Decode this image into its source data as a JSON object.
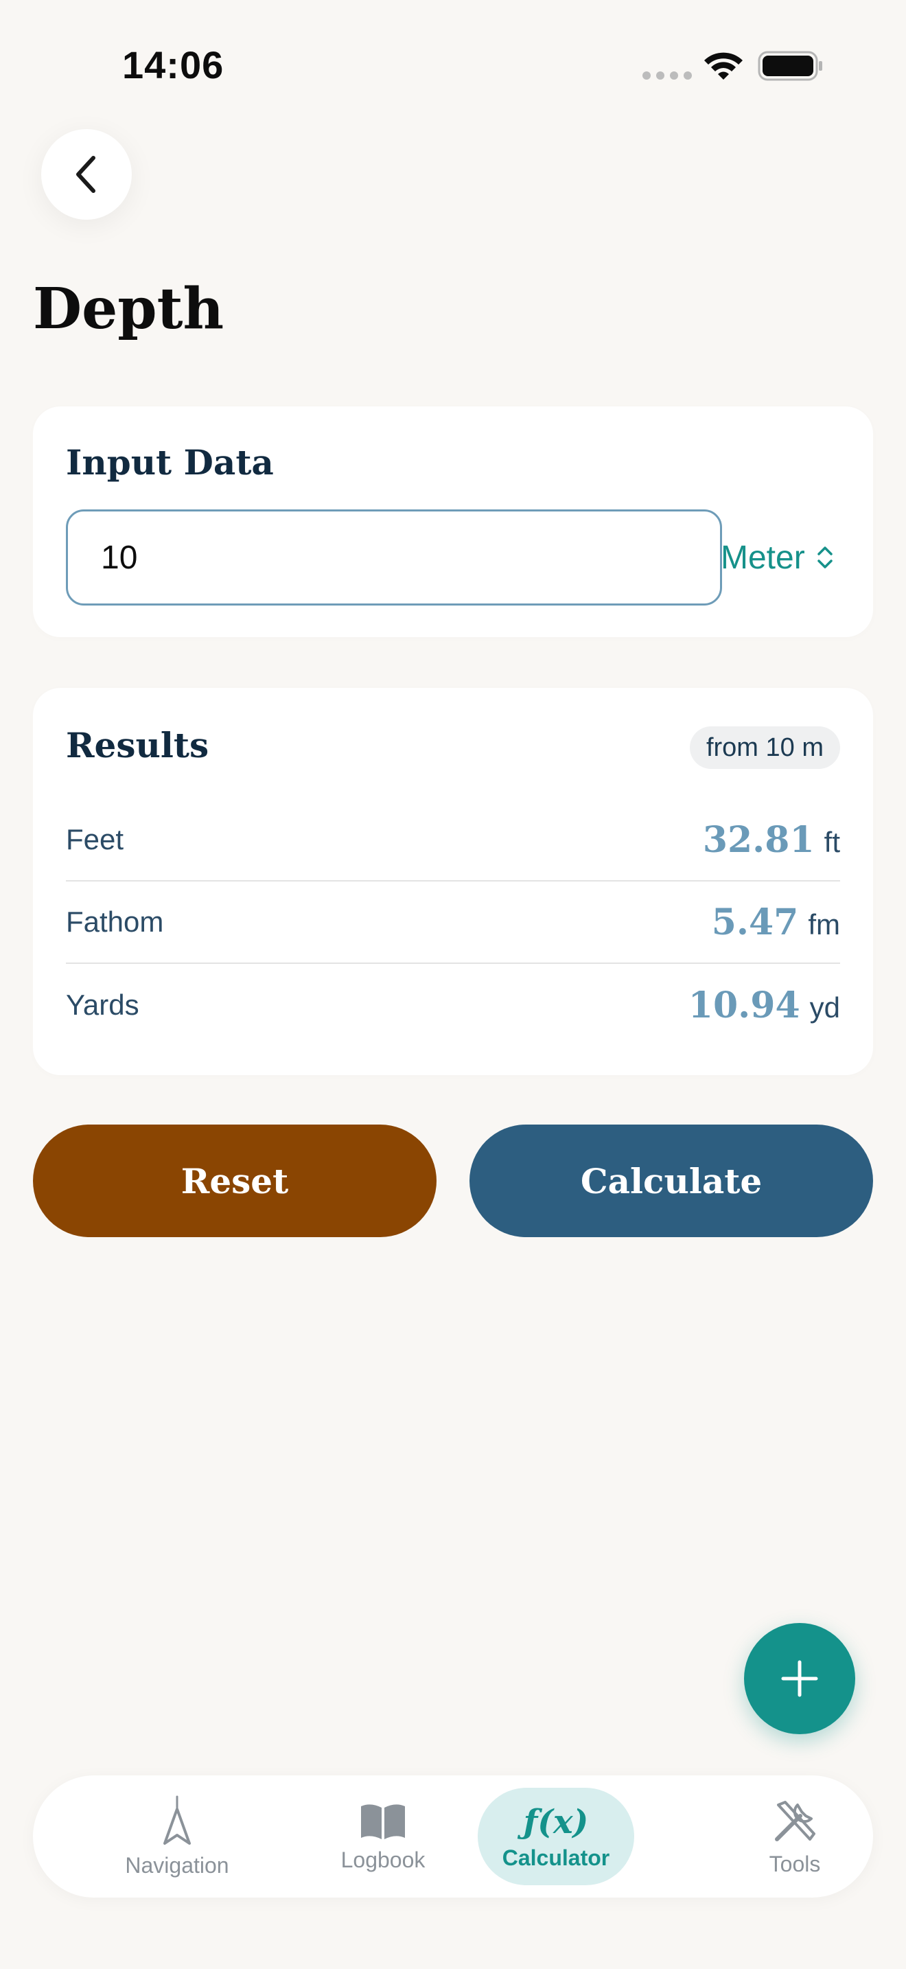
{
  "status_bar": {
    "time": "14:06"
  },
  "page": {
    "title": "Depth"
  },
  "input_card": {
    "title": "Input Data",
    "value": "10",
    "unit": "Meter"
  },
  "results_card": {
    "title": "Results",
    "badge": "from 10 m",
    "rows": [
      {
        "label": "Feet",
        "value": "32.81",
        "unit": "ft"
      },
      {
        "label": "Fathom",
        "value": "5.47",
        "unit": "fm"
      },
      {
        "label": "Yards",
        "value": "10.94",
        "unit": "yd"
      }
    ]
  },
  "actions": {
    "reset_label": "Reset",
    "calculate_label": "Calculate"
  },
  "tabs": [
    {
      "label": "Navigation",
      "icon": "compass-needle-icon"
    },
    {
      "label": "Logbook",
      "icon": "book-icon"
    },
    {
      "label": "Calculator",
      "icon": "function-icon",
      "glyph": "ƒ(x)",
      "active": true
    },
    {
      "label": "Tools",
      "icon": "tools-icon"
    }
  ],
  "colors": {
    "accent": "#14928b",
    "reset": "#8a4502",
    "calculate": "#2d5e80",
    "result_value": "#6a9ab8",
    "background": "#f9f7f4"
  }
}
